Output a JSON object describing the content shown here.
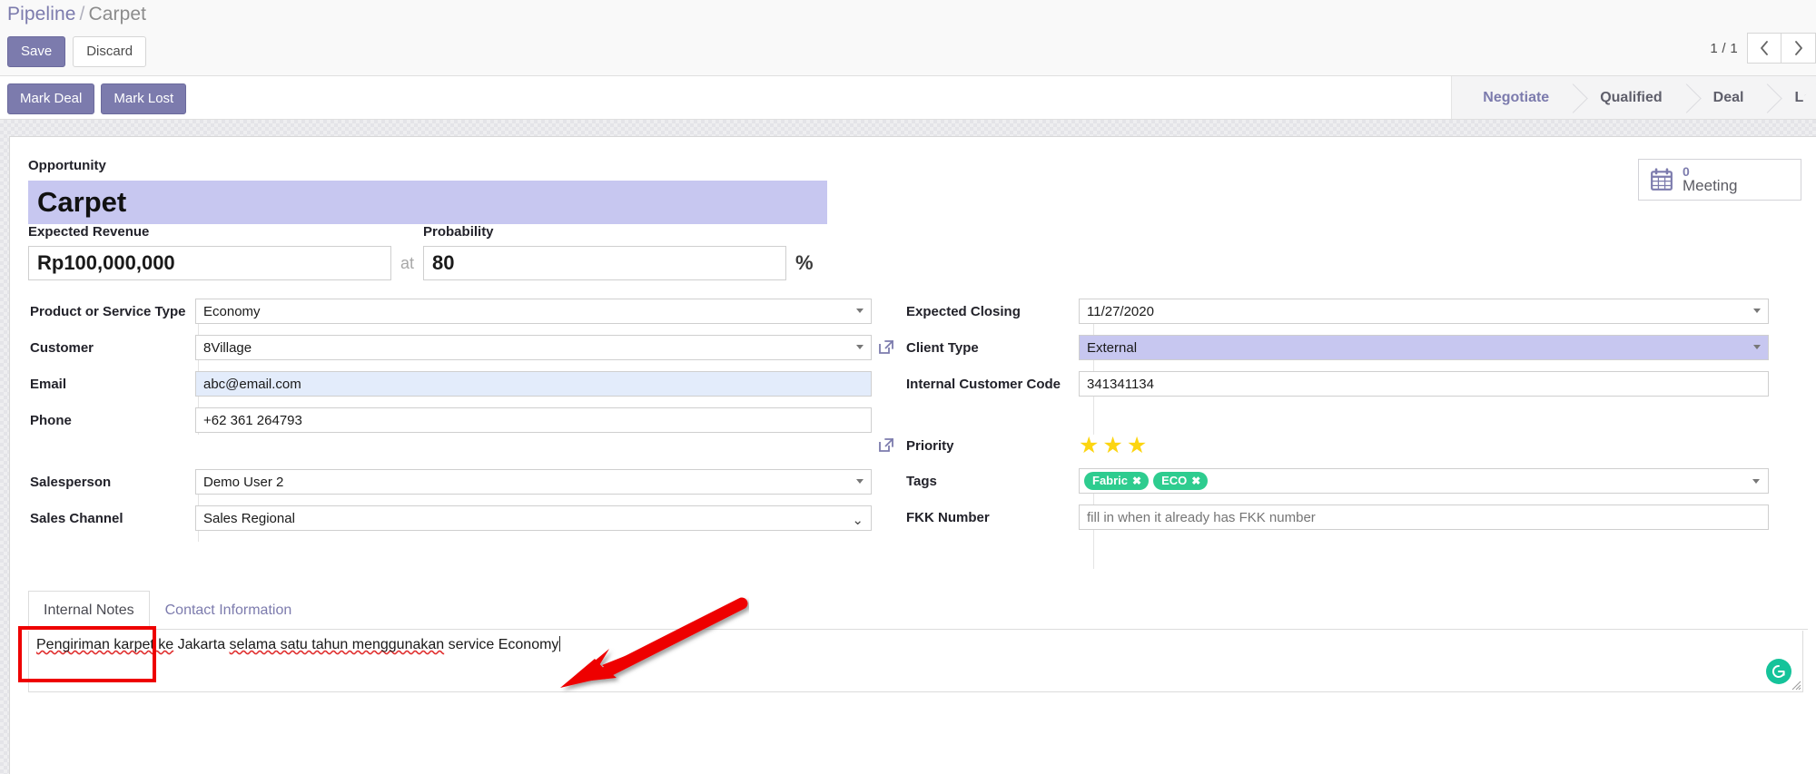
{
  "breadcrumb": {
    "root": "Pipeline",
    "separator": "/",
    "current": "Carpet"
  },
  "toolbar": {
    "save_label": "Save",
    "discard_label": "Discard",
    "mark_deal_label": "Mark Deal",
    "mark_lost_label": "Mark Lost"
  },
  "pager": {
    "count": "1 / 1",
    "prev_icon": "chevron-left-icon",
    "next_icon": "chevron-right-icon"
  },
  "statusbar": {
    "stages": [
      {
        "label": "Negotiate",
        "active": true
      },
      {
        "label": "Qualified",
        "active": false
      },
      {
        "label": "Deal",
        "active": false
      },
      {
        "label": "Lo",
        "active": false
      }
    ]
  },
  "smart_button": {
    "icon": "calendar-icon",
    "count": "0",
    "label": "Meeting"
  },
  "form": {
    "opportunity_label": "Opportunity",
    "opportunity_value": "Carpet",
    "expected_revenue_label": "Expected Revenue",
    "expected_revenue_value": "Rp100,000,000",
    "at_word": "at",
    "probability_label": "Probability",
    "probability_value": "80",
    "percent_sign": "%",
    "product_type_label": "Product or Service Type",
    "product_type_value": "Economy",
    "customer_label": "Customer",
    "customer_value": "8Village",
    "email_label": "Email",
    "email_value": "abc@email.com",
    "phone_label": "Phone",
    "phone_value": "+62 361 264793",
    "expected_closing_label": "Expected Closing",
    "expected_closing_value": "11/27/2020",
    "client_type_label": "Client Type",
    "client_type_value": "External",
    "internal_code_label": "Internal Customer Code",
    "internal_code_value": "341341134",
    "salesperson_label": "Salesperson",
    "salesperson_value": "Demo User 2",
    "sales_channel_label": "Sales Channel",
    "sales_channel_value": "Sales Regional",
    "priority_label": "Priority",
    "priority_stars": 3,
    "tags_label": "Tags",
    "tags": [
      {
        "name": "Fabric",
        "remove": "✖"
      },
      {
        "name": "ECO",
        "remove": "✖"
      }
    ],
    "fkk_label": "FKK Number",
    "fkk_value": "",
    "fkk_placeholder": "fill in when it already has FKK number"
  },
  "notebook": {
    "tabs": [
      {
        "label": "Internal Notes",
        "active": true
      },
      {
        "label": "Contact Information",
        "active": false
      }
    ],
    "internal_notes": {
      "part1": "Pengiriman karpet ke",
      "part2": " Jakarta ",
      "part3": "selama satu tahun menggunakan",
      "part4": " service Economy"
    },
    "grammarly_icon": "grammarly-icon"
  },
  "colors": {
    "odoo_purple": "#7c7bad",
    "highlight_purple": "#c7c7f0",
    "highlight_blue": "#e3ecfb",
    "tag_green": "#2ecc8f",
    "star_yellow": "#fcd511",
    "annotation_red": "#ee0000",
    "grammarly_green": "#15c39a"
  }
}
